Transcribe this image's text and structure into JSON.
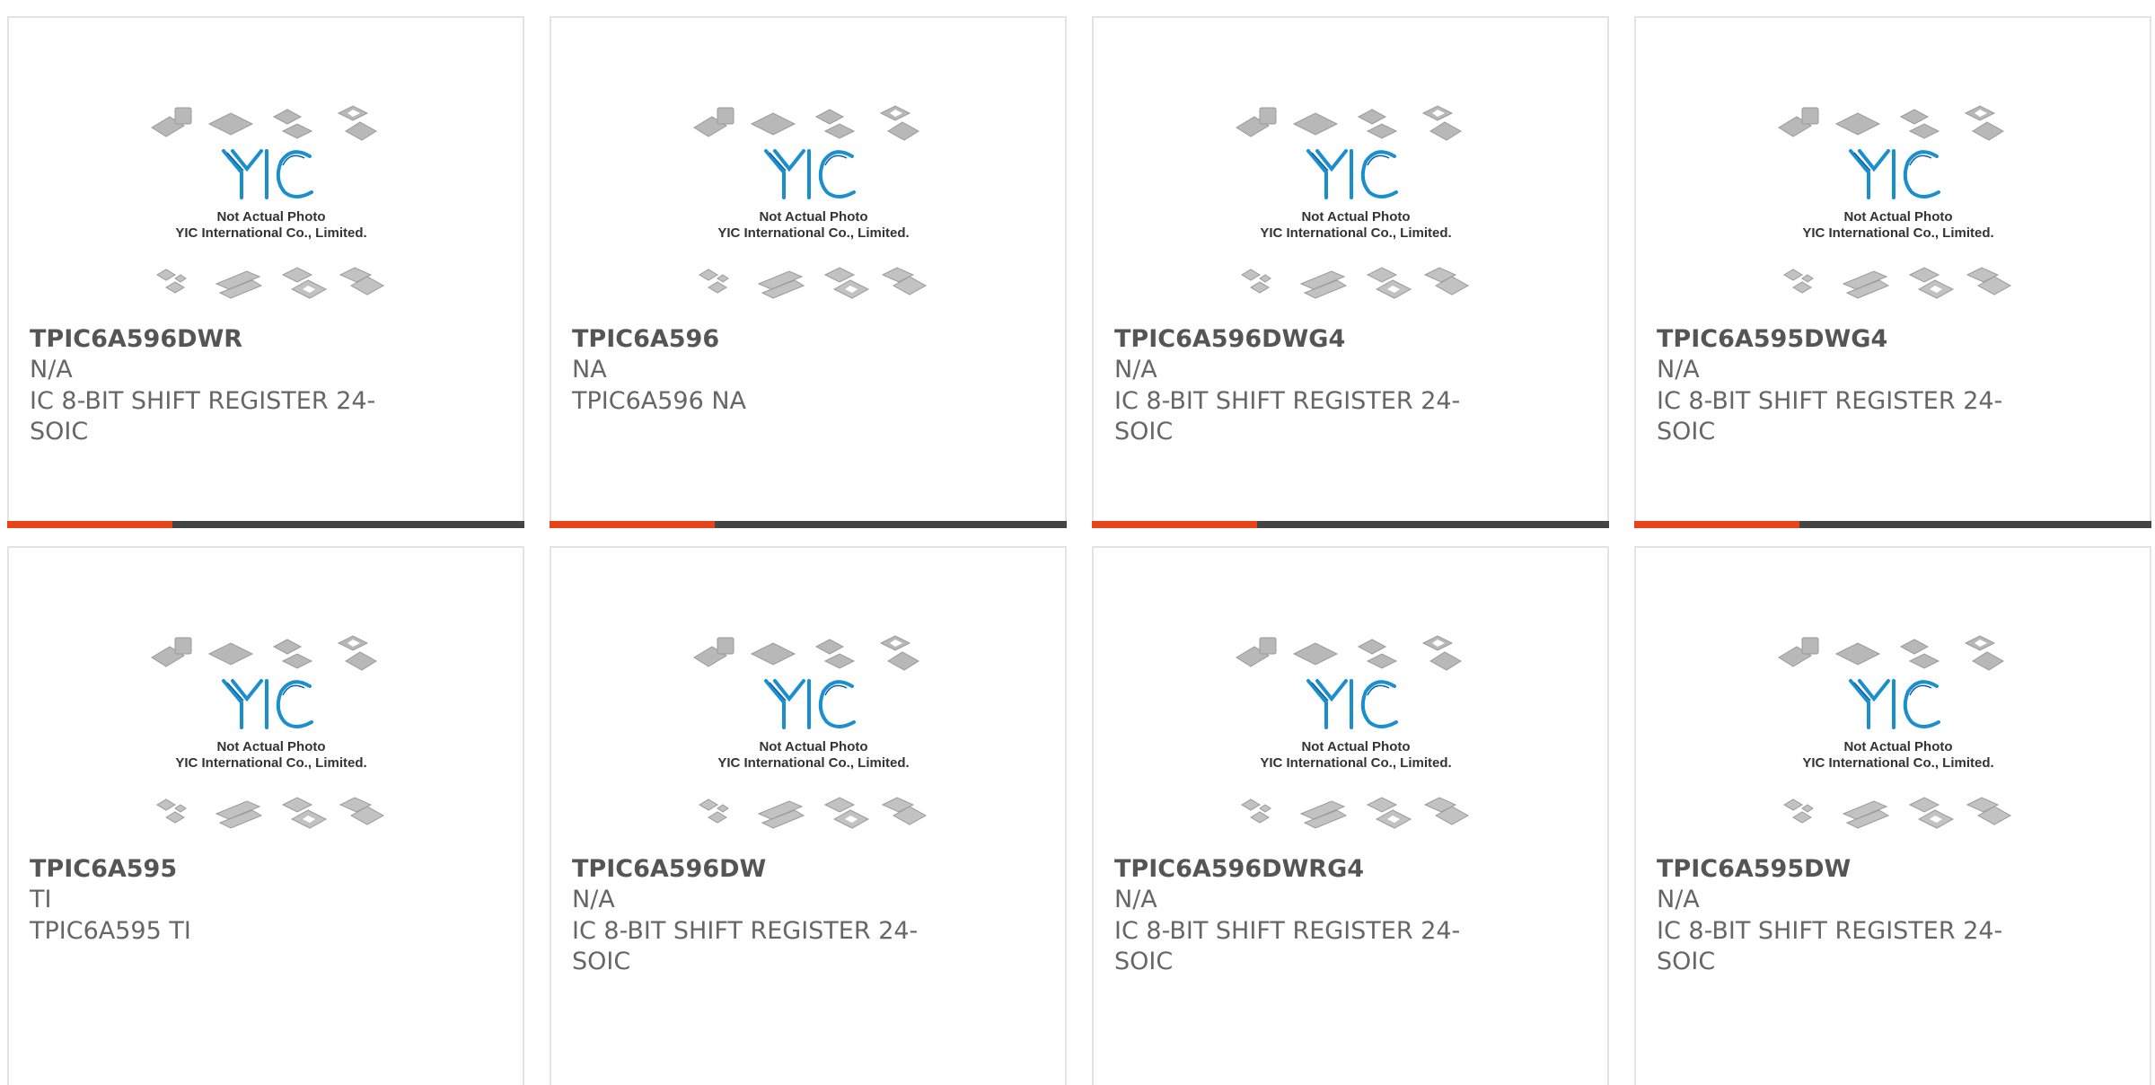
{
  "photo": {
    "logo_text": "YIC",
    "line1": "Not Actual Photo",
    "line2": "YIC International Co., Limited."
  },
  "colors": {
    "accent": "#e8441a",
    "bar": "#454545",
    "logo": "#1a8fd0",
    "chip": "#b5b5b5",
    "text": "#666666"
  },
  "products": [
    {
      "part": "TPIC6A596DWR",
      "brand": "N/A",
      "desc": "IC 8-BIT SHIFT REGISTER 24-SOIC"
    },
    {
      "part": "TPIC6A596",
      "brand": "NA",
      "desc": "TPIC6A596 NA"
    },
    {
      "part": "TPIC6A596DWG4",
      "brand": "N/A",
      "desc": "IC 8-BIT SHIFT REGISTER 24-SOIC"
    },
    {
      "part": "TPIC6A595DWG4",
      "brand": "N/A",
      "desc": "IC 8-BIT SHIFT REGISTER 24-SOIC"
    },
    {
      "part": "TPIC6A595",
      "brand": "TI",
      "desc": "TPIC6A595 TI"
    },
    {
      "part": "TPIC6A596DW",
      "brand": "N/A",
      "desc": "IC 8-BIT SHIFT REGISTER 24-SOIC"
    },
    {
      "part": "TPIC6A596DWRG4",
      "brand": "N/A",
      "desc": "IC 8-BIT SHIFT REGISTER 24-SOIC"
    },
    {
      "part": "TPIC6A595DW",
      "brand": "N/A",
      "desc": "IC 8-BIT SHIFT REGISTER 24-SOIC"
    }
  ]
}
